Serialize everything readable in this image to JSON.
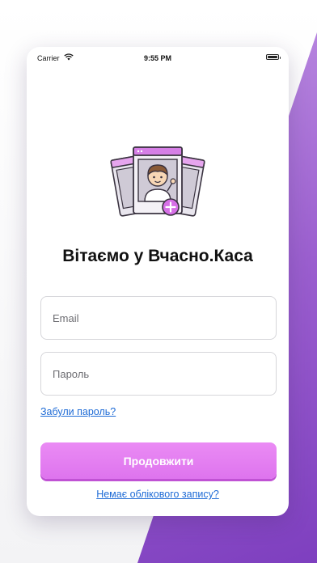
{
  "status_bar": {
    "carrier": "Carrier",
    "time": "9:55 PM"
  },
  "illustration": {
    "icon": "profile-cards-with-add-icon",
    "accent_color": "#d66fe6"
  },
  "login": {
    "title": "Вітаємо у Вчасно.Каса",
    "email_placeholder": "Email",
    "password_placeholder": "Пароль",
    "forgot_password": "Забули пароль?",
    "continue_label": "Продовжити",
    "no_account": "Немає облікового запису?"
  },
  "colors": {
    "primary_button": "#e080f0",
    "link": "#1e6bd6",
    "background_accent": "#9b5fcf"
  }
}
